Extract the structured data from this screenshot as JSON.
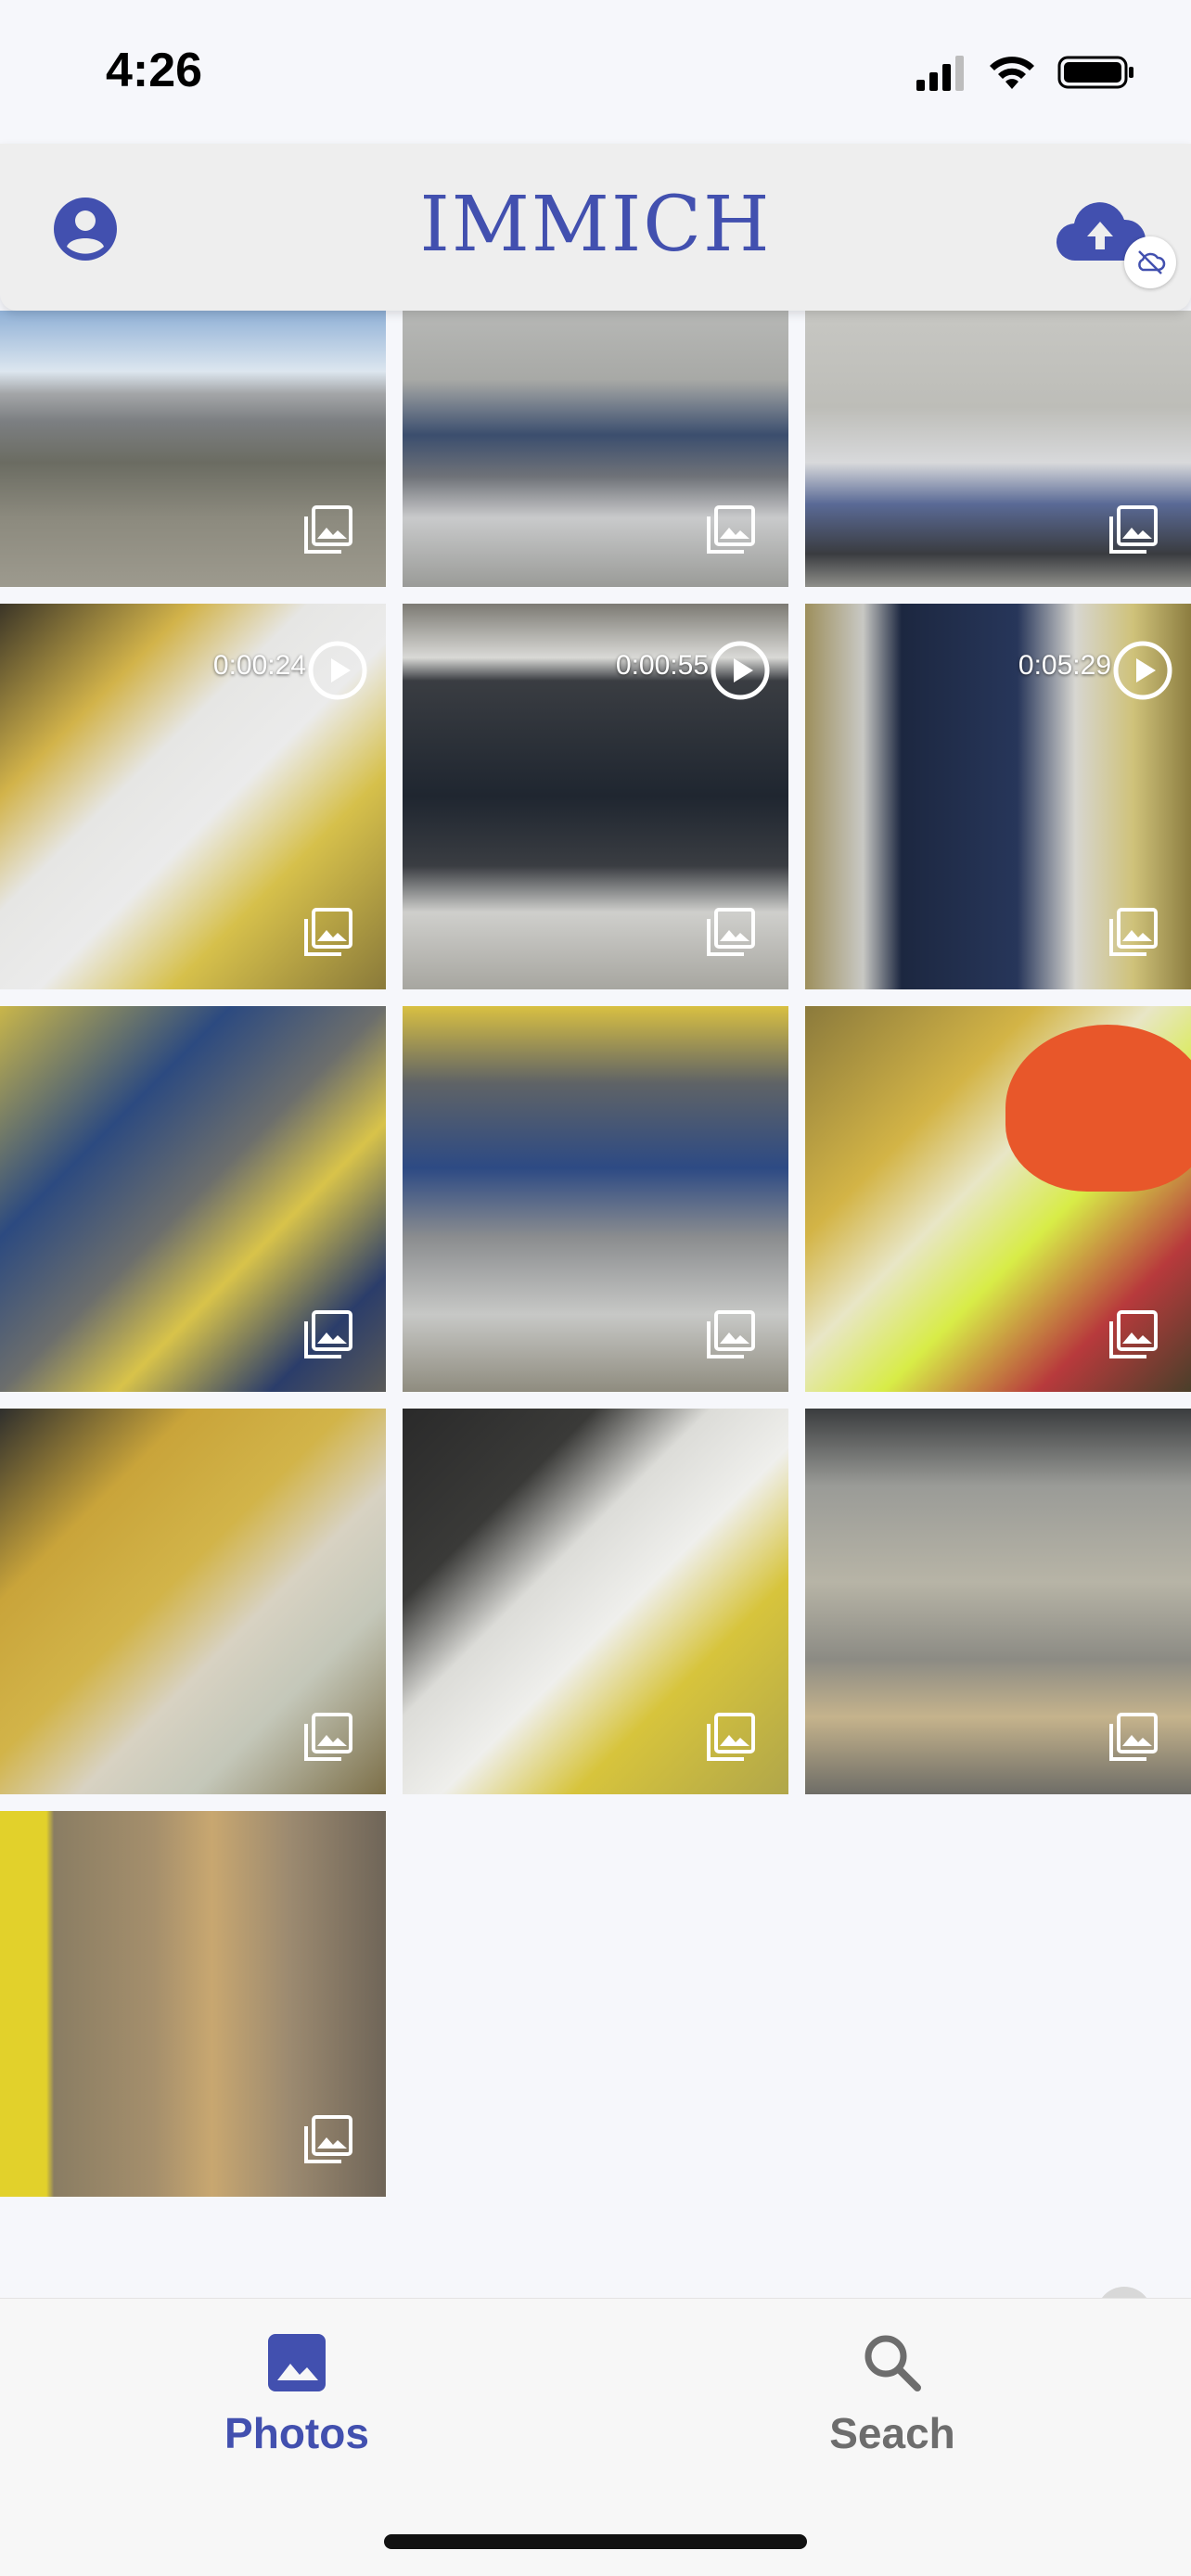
{
  "status_bar": {
    "time": "4:26"
  },
  "app_bar": {
    "title": "IMMICH"
  },
  "colors": {
    "accent": "#4250af",
    "background": "#f6f7fb"
  },
  "grid": {
    "items": [
      {
        "type": "photo",
        "icon": "image-icon"
      },
      {
        "type": "photo",
        "icon": "image-icon"
      },
      {
        "type": "photo",
        "icon": "image-icon"
      },
      {
        "type": "video",
        "duration": "0:00:24",
        "icon": "image-icon"
      },
      {
        "type": "video",
        "duration": "0:00:55",
        "icon": "image-icon"
      },
      {
        "type": "video",
        "duration": "0:05:29",
        "icon": "image-icon"
      },
      {
        "type": "photo",
        "icon": "image-icon"
      },
      {
        "type": "photo",
        "icon": "image-icon"
      },
      {
        "type": "photo",
        "icon": "image-icon"
      },
      {
        "type": "photo",
        "icon": "image-icon"
      },
      {
        "type": "photo",
        "icon": "image-icon"
      },
      {
        "type": "photo",
        "icon": "image-icon"
      },
      {
        "type": "photo",
        "icon": "image-icon"
      }
    ]
  },
  "bottom_nav": {
    "items": [
      {
        "label": "Photos",
        "icon": "photo-icon",
        "active": true
      },
      {
        "label": "Seach",
        "icon": "search-icon",
        "active": false
      }
    ]
  }
}
